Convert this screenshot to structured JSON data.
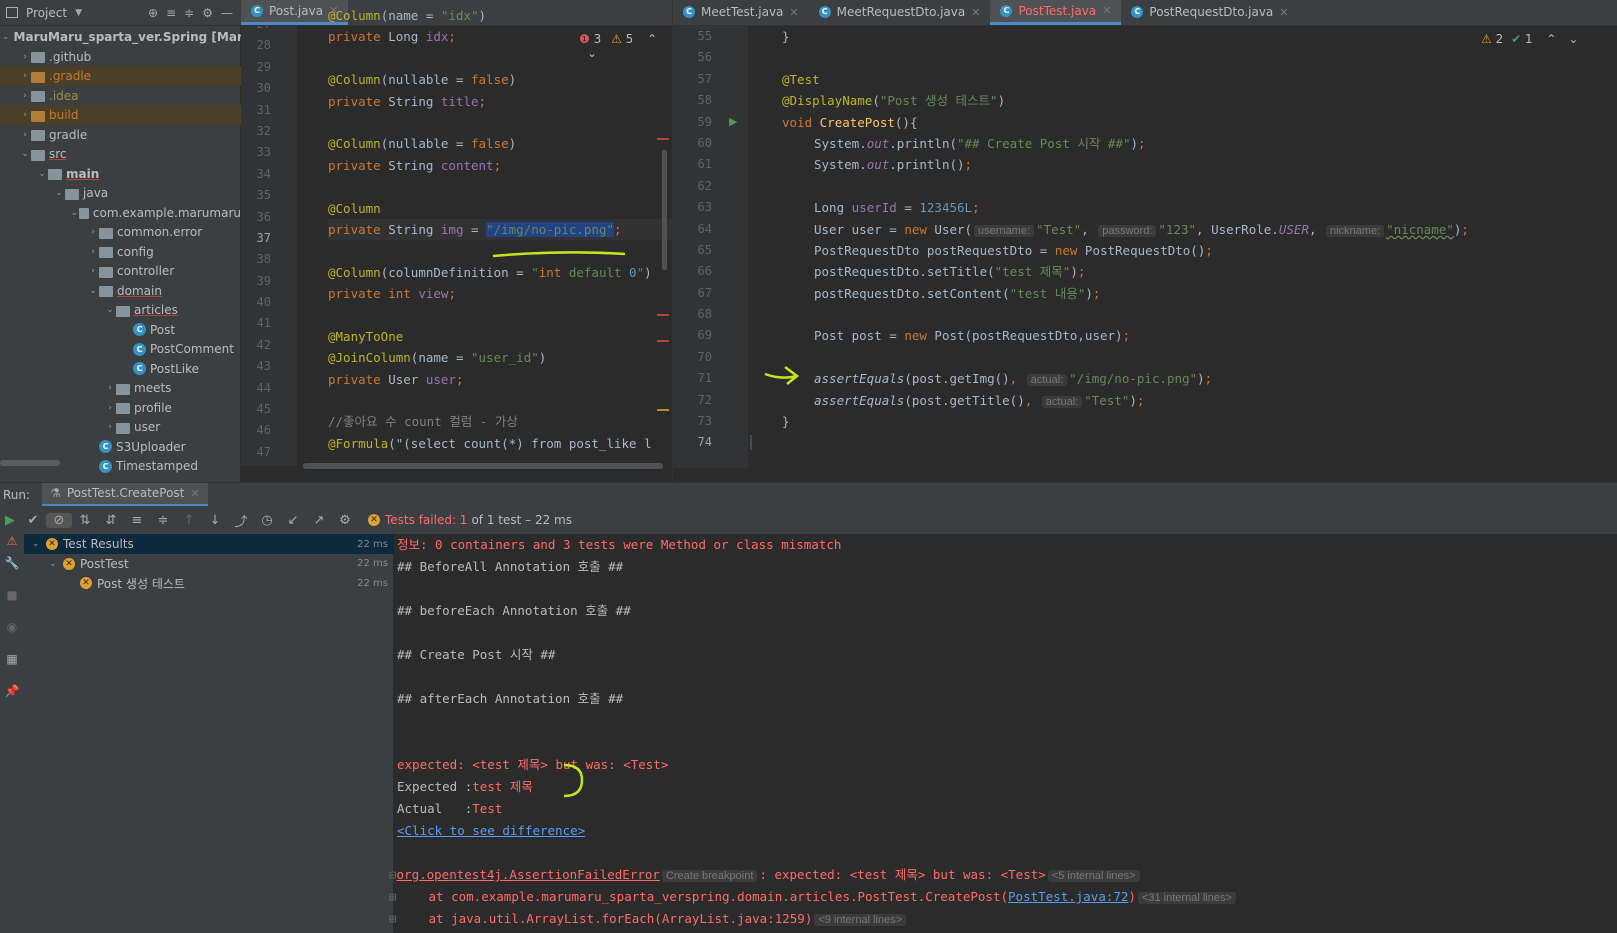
{
  "project": {
    "title": "Project",
    "items": [
      {
        "label": "MaruMaru_sparta_ver.Spring [MaruM",
        "bold": "MaruMaru_sparta_ver.Spring [MaruM"
      },
      {
        "label": ".github"
      },
      {
        "label": ".gradle"
      },
      {
        "label": ".idea"
      },
      {
        "label": "build"
      },
      {
        "label": "gradle"
      },
      {
        "label": "src"
      },
      {
        "label": "main"
      },
      {
        "label": "java"
      },
      {
        "label": "com.example.marumaru"
      },
      {
        "label": "common.error"
      },
      {
        "label": "config"
      },
      {
        "label": "controller"
      },
      {
        "label": "domain"
      },
      {
        "label": "articles"
      },
      {
        "label": "Post"
      },
      {
        "label": "PostComment"
      },
      {
        "label": "PostLike"
      },
      {
        "label": "meets"
      },
      {
        "label": "profile"
      },
      {
        "label": "user"
      },
      {
        "label": "S3Uploader"
      },
      {
        "label": "Timestamped"
      }
    ]
  },
  "left_editor": {
    "tab": "Post.java",
    "errors": "3",
    "warnings": "5",
    "line_numbers": [
      "27",
      "28",
      "29",
      "30",
      "31",
      "32",
      "33",
      "34",
      "35",
      "36",
      "37",
      "38",
      "39",
      "40",
      "41",
      "42",
      "43",
      "44",
      "45",
      "46",
      "47"
    ],
    "lines": [
      "@Column(name = \"idx\")",
      "private Long idx;",
      "",
      "@Column(nullable = false)",
      "private String title;",
      "",
      "@Column(nullable = false)",
      "private String content;",
      "",
      "@Column",
      "private String img = \"/img/no-pic.png\";",
      "",
      "@Column(columnDefinition = \"int default 0\")",
      "private int view;",
      "",
      "@ManyToOne",
      "@JoinColumn(name = \"user_id\")",
      "private User user;",
      "",
      "//좋아요 수 count 컬럼 - 가상",
      "@Formula(\"(select count(*) from post_like l"
    ]
  },
  "right_editor": {
    "tabs": [
      "MeetTest.java",
      "MeetRequestDto.java",
      "PostTest.java",
      "PostRequestDto.java"
    ],
    "active_tab": "PostTest.java",
    "warnings": "2",
    "ok": "1",
    "line_numbers": [
      "55",
      "56",
      "57",
      "58",
      "59",
      "60",
      "61",
      "62",
      "63",
      "64",
      "65",
      "66",
      "67",
      "68",
      "69",
      "70",
      "71",
      "72",
      "73",
      "74"
    ],
    "lines": [
      "}",
      "",
      "@Test",
      "@DisplayName(\"Post 생성 테스트\")",
      "void CreatePost(){",
      "System.out.println(\"## Create Post 시작 ##\");",
      "System.out.println();",
      "",
      "Long userId = 123456L;",
      "User user = new User(username: \"Test\", password: \"123\", UserRole.USER, nickname: \"nicname\");",
      "PostRequestDto postRequestDto = new PostRequestDto();",
      "postRequestDto.setTitle(\"test 제목\");",
      "postRequestDto.setContent(\"test 내용\");",
      "",
      "Post post = new Post(postRequestDto,user);",
      "",
      "assertEquals(post.getImg(), actual: \"/img/no-pic.png\");",
      "assertEquals(post.getTitle(), actual: \"Test\");",
      "}",
      "}"
    ],
    "hints": {
      "username": "username:",
      "password": "password:",
      "nickname": "nickname:",
      "actual": "actual:"
    }
  },
  "run": {
    "label": "Run:",
    "tab": "PostTest.CreatePost",
    "status_failed": "Tests failed: 1",
    "status_rest": "of 1 test – 22 ms",
    "tree": [
      {
        "label": "Test Results",
        "time": "22 ms"
      },
      {
        "label": "PostTest",
        "time": "22 ms"
      },
      {
        "label": "Post 생성 테스트",
        "time": "22 ms"
      }
    ],
    "console": [
      "정보: 0 containers and 3 tests were Method or class mismatch",
      "## BeforeAll Annotation 호출 ##",
      "",
      "## beforeEach Annotation 호출 ##",
      "",
      "## Create Post 시작 ##",
      "",
      "## afterEach Annotation 호출 ##",
      "",
      "",
      "expected: <test 제목> but was: <Test>",
      "Expected :test 제목",
      "Actual   :Test",
      "<Click to see difference>",
      "",
      "org.opentest4j.AssertionFailedError",
      "at com.example.marumaru_sparta_verspring.domain.articles.PostTest.CreatePost(",
      "at java.util.ArrayList.forEach(ArrayList.java:1259)"
    ],
    "breakpoint": "Create breakpoint",
    "assert_msg": ": expected: <test 제목> but was: <Test>",
    "internal5": "<5 internal lines>",
    "posttest_link": "PostTest.java:72",
    "internal31": "<31 internal lines>",
    "internal9": "<9 internal lines>",
    "expected_prefix": "Expected :",
    "expected_val": "test 제목",
    "actual_prefix": "Actual   :",
    "actual_val": "Test"
  }
}
